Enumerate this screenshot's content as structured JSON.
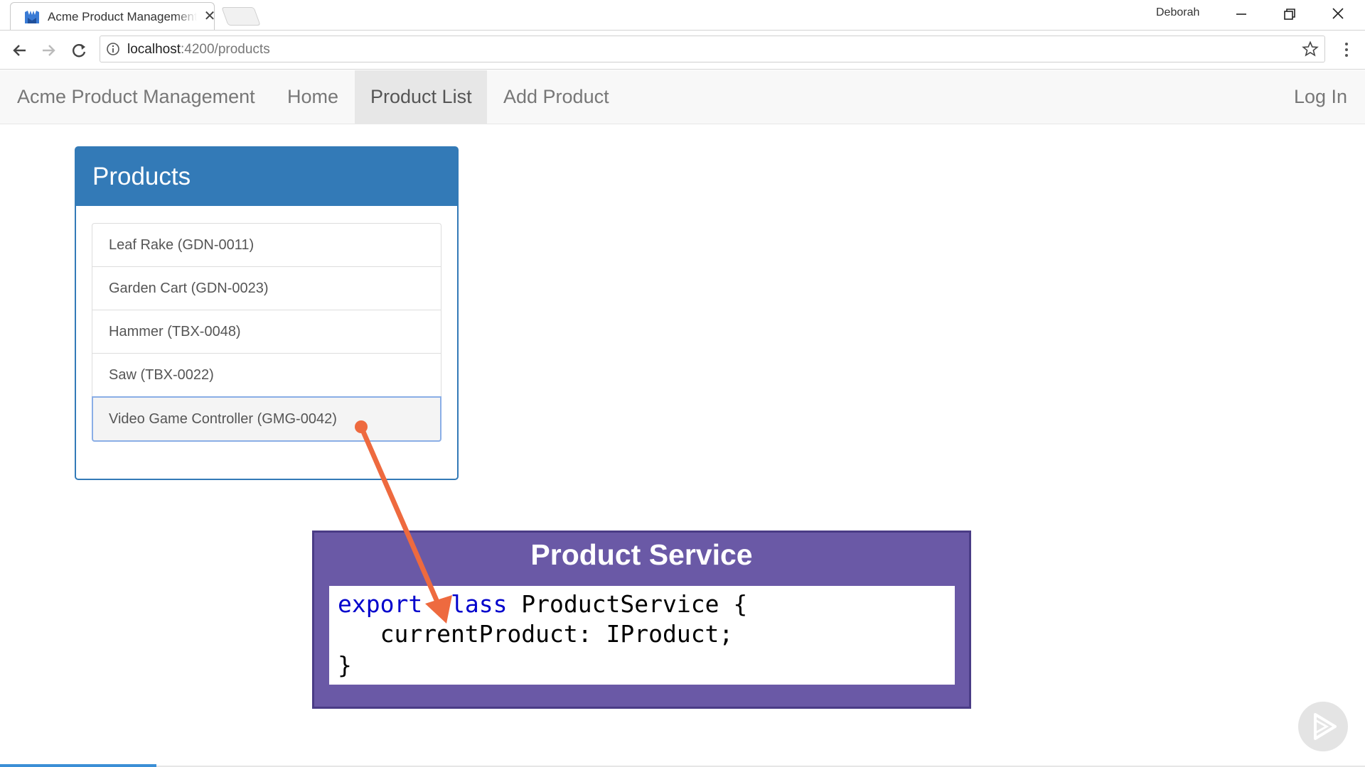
{
  "browser": {
    "tab_title": "Acme Product Management",
    "tab_close": "✕",
    "profile_name": "Deborah",
    "url_host": "localhost",
    "url_path": ":4200/products",
    "icons": [
      "app-favicon",
      "close-icon",
      "back-icon",
      "forward-icon",
      "reload-icon",
      "info-icon",
      "star-icon",
      "menu-icon",
      "minimize-icon",
      "restore-icon",
      "window-close-icon"
    ]
  },
  "navbar": {
    "brand": "Acme Product Management",
    "links": [
      {
        "label": "Home",
        "active": false
      },
      {
        "label": "Product List",
        "active": true
      },
      {
        "label": "Add Product",
        "active": false
      }
    ],
    "login": "Log In"
  },
  "products_panel": {
    "title": "Products",
    "items": [
      {
        "label": "Leaf Rake (GDN-0011)",
        "selected": false
      },
      {
        "label": "Garden Cart (GDN-0023)",
        "selected": false
      },
      {
        "label": "Hammer (TBX-0048)",
        "selected": false
      },
      {
        "label": "Saw (TBX-0022)",
        "selected": false
      },
      {
        "label": "Video Game Controller (GMG-0042)",
        "selected": true
      }
    ]
  },
  "service_callout": {
    "title": "Product Service",
    "code": {
      "line1_keyword1": "export",
      "line1_space": " ",
      "line1_keyword2": "class",
      "line1_rest": " ProductService {",
      "line2": "   currentProduct: IProduct;",
      "line3": "}"
    }
  },
  "colors": {
    "panel_primary": "#337ab7",
    "callout_bg": "#6a59a6",
    "arrow": "#ee6a3f",
    "keyword": "#0000cc"
  }
}
